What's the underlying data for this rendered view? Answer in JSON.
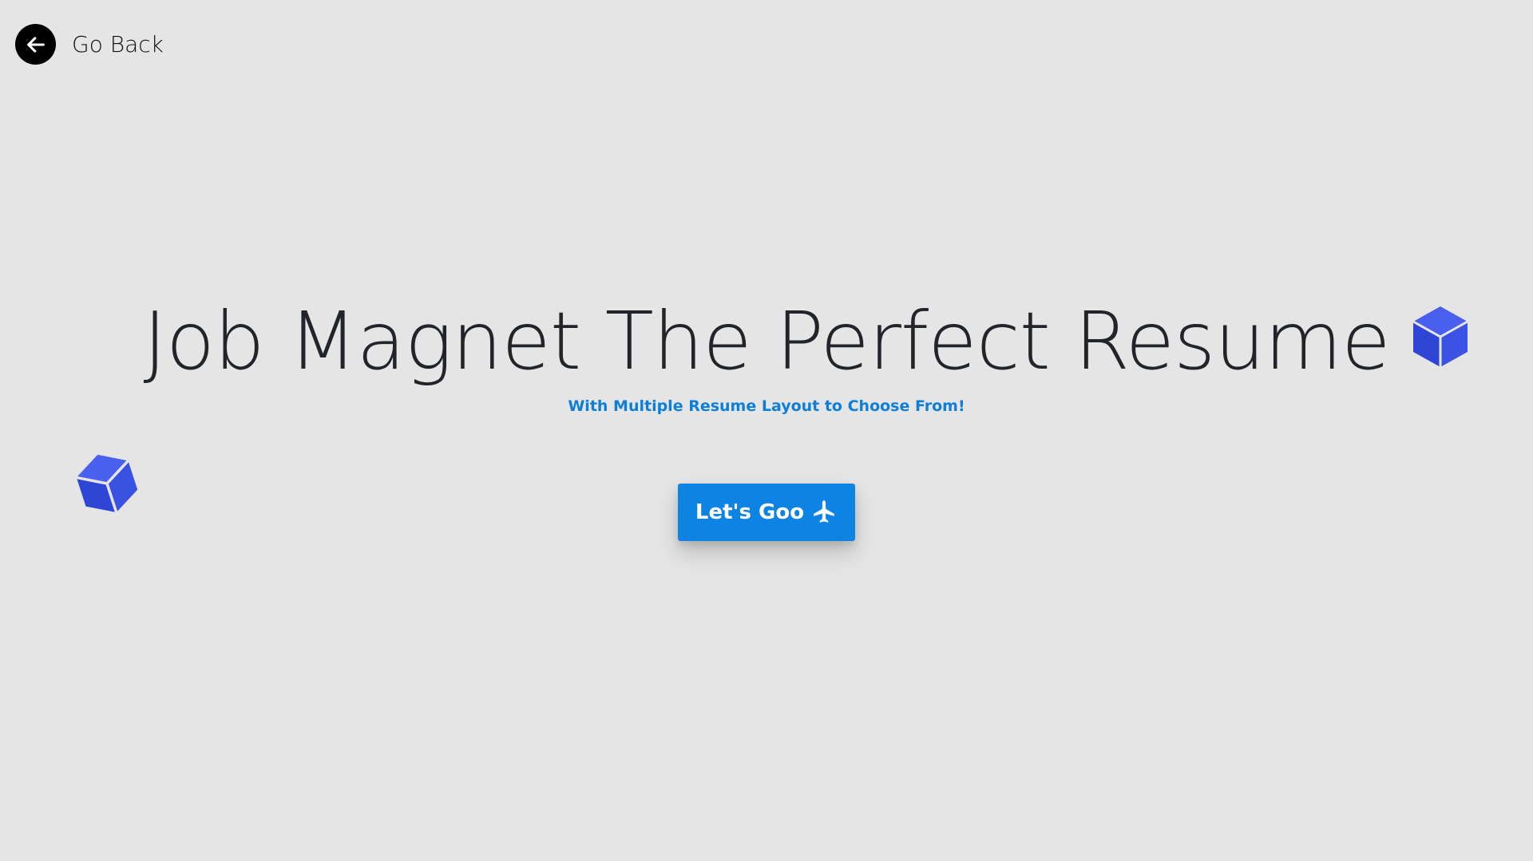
{
  "nav": {
    "back_label": "Go Back",
    "back_icon": "arrow-left-icon"
  },
  "hero": {
    "title": "Job Magnet The Perfect Resume",
    "subtitle": "With Multiple Resume Layout to Choose From!",
    "cta_label": "Let's Goo",
    "cta_icon": "airplane-icon"
  },
  "decorations": {
    "cube_icon": "cube-icon"
  },
  "colors": {
    "background": "#e5e5e6",
    "accent": "#0d84e3",
    "subtitle": "#0d7fd9",
    "cube": "#3a4fe0"
  }
}
